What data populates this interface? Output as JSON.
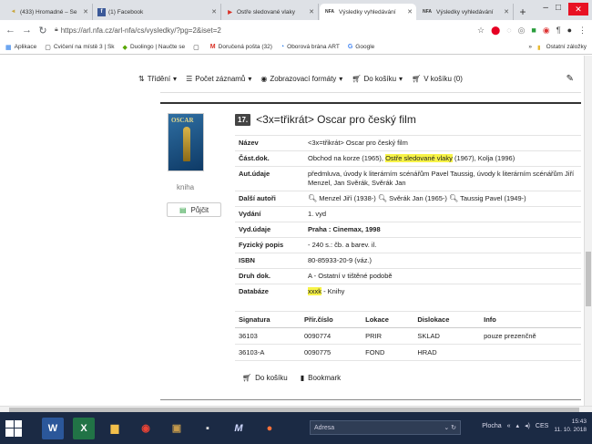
{
  "browser": {
    "tabs": [
      {
        "title": "(433) Hromadné – Se",
        "favicon": "◄",
        "favicon_color": "#c8a53a"
      },
      {
        "title": "(1) Facebook",
        "favicon": "f",
        "favicon_color": "#3b5998"
      },
      {
        "title": "Ostře sledované vlaky",
        "favicon": "▶",
        "favicon_color": "#d93025"
      },
      {
        "title": "Výsledky vyhledávání",
        "favicon": "NFA",
        "favicon_color": "#333333",
        "active": true
      },
      {
        "title": "Výsledky vyhledávání",
        "favicon": "NFA",
        "favicon_color": "#333333"
      }
    ],
    "url": "https://arl.nfa.cz/arl-nfa/cs/vysledky/?pg=2&iset=2",
    "bookmarks": [
      {
        "label": "Aplikace",
        "icon": "▦"
      },
      {
        "label": "Cvičení na místě 3 | Sk",
        "icon": "▢"
      },
      {
        "label": "Duolingo | Naučte se",
        "icon": "◆"
      },
      {
        "label": "",
        "icon": "▢"
      },
      {
        "label": "Doručená pošta (32)",
        "icon": "M"
      },
      {
        "label": "Oborová brána ART",
        "icon": "◔"
      },
      {
        "label": "Google",
        "icon": "G"
      }
    ],
    "bookmarks_other": "Ostatní záložky"
  },
  "toolbar": {
    "sort": "Třídění",
    "count": "Počet záznamů",
    "formats": "Zobrazovací formáty",
    "to_cart": "Do košíku",
    "in_cart": "V košíku (0)"
  },
  "record": {
    "number": "17.",
    "title": "<3x=třikrát> Oscar pro český film",
    "cover_caption": "kniha",
    "cover_logo": "OSCAR",
    "borrow_label": "Půjčit",
    "fields": {
      "nazev_label": "Název",
      "nazev": "<3x=třikrát> Oscar pro český film",
      "cast_label": "Část.dok.",
      "cast_a": "Obchod na korze (1965), ",
      "cast_hl": "Ostře sledované vlaky",
      "cast_b": " (1967), Kolja (1996)",
      "aut_label": "Aut.údaje",
      "aut": "předmluva, úvody k literárním scénářům Pavel Taussig, úvody k literárním scénářům Jiří Menzel, Jan Svěrák, Svěrák Jan",
      "dalsi_label": "Další autoři",
      "dalsi_1": "Menzel Jiří (1938-)",
      "dalsi_2": "Svěrák Jan (1965-)",
      "dalsi_3": "Taussig Pavel (1949-)",
      "vydani_label": "Vydání",
      "vydani": "1. vyd",
      "vyd_label": "Vyd.údaje",
      "vyd": "Praha : Cinemax, 1998",
      "fyz_label": "Fyzický popis",
      "fyz": "- 240 s.: čb. a barev. il.",
      "isbn_label": "ISBN",
      "isbn": "80-85933-20-9 (váz.)",
      "druh_label": "Druh dok.",
      "druh": "A - Ostatní v tištěné podobě",
      "db_label": "Databáze",
      "db_hl": "xxxk",
      "db": " - Knihy"
    }
  },
  "holdings": {
    "headers": [
      "Signatura",
      "Přír.číslo",
      "Lokace",
      "Dislokace",
      "Info"
    ],
    "rows": [
      [
        "36103",
        "0090774",
        "PRIR",
        "SKLAD",
        "pouze prezenčně"
      ],
      [
        "36103-A",
        "0090775",
        "FOND",
        "HRAD",
        ""
      ]
    ]
  },
  "actions": {
    "cart": "Do košíku",
    "bookmark": "Bookmark"
  },
  "taskbar": {
    "address_label": "Adresa",
    "desktop_label": "Plocha",
    "lang": "CES",
    "time": "15:43",
    "date": "11. 10. 2018"
  }
}
